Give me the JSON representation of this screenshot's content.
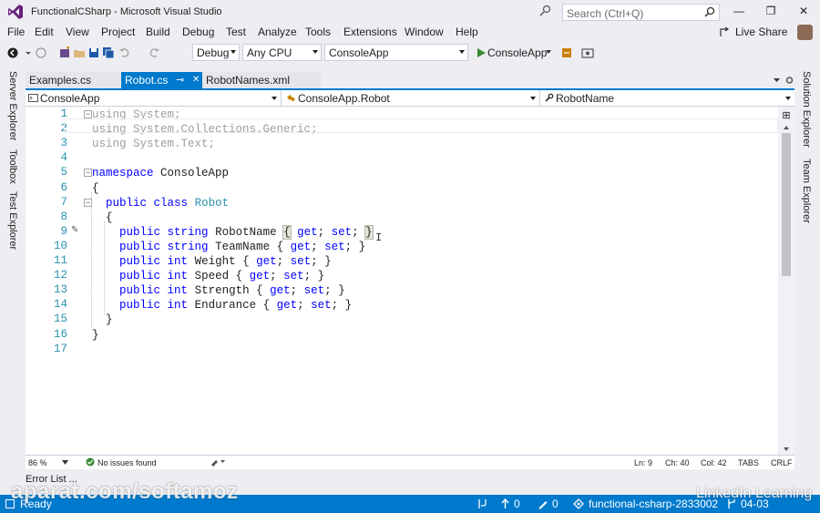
{
  "window": {
    "title": "FunctionalCSharp - Microsoft Visual Studio",
    "search_placeholder": "Search (Ctrl+Q)",
    "minimize": "—",
    "maximize": "❐",
    "close": "✕"
  },
  "menu": [
    "File",
    "Edit",
    "View",
    "Project",
    "Build",
    "Debug",
    "Test",
    "Analyze",
    "Tools",
    "Extensions",
    "Window",
    "Help"
  ],
  "live_share": "Live Share",
  "toolbar": {
    "config": "Debug",
    "platform": "Any CPU",
    "startup_project": "ConsoleApp",
    "run_target": "ConsoleApp"
  },
  "left_rail": [
    "Server Explorer",
    "Toolbox",
    "Test Explorer"
  ],
  "right_rail": [
    "Solution Explorer",
    "Team Explorer"
  ],
  "tabs": [
    {
      "label": "Examples.cs",
      "active": false
    },
    {
      "label": "Robot.cs",
      "active": true
    },
    {
      "label": "RobotNames.xml",
      "active": false
    }
  ],
  "tab_pin": "⊸",
  "tab_close": "✕",
  "navbar": {
    "project": "ConsoleApp",
    "type": "ConsoleApp.Robot",
    "member": "RobotName"
  },
  "code": {
    "line_numbers": [
      "1",
      "2",
      "3",
      "4",
      "5",
      "6",
      "7",
      "8",
      "9",
      "10",
      "11",
      "12",
      "13",
      "14",
      "15",
      "16",
      "17"
    ],
    "lines": [
      [
        {
          "t": "using System;",
          "c": "dim"
        }
      ],
      [
        {
          "t": "using System.Collections.Generic;",
          "c": "dim"
        }
      ],
      [
        {
          "t": "using System.Text;",
          "c": "dim"
        }
      ],
      [],
      [
        {
          "t": "namespace",
          "c": "kw"
        },
        {
          "t": " ConsoleApp",
          "c": ""
        }
      ],
      [
        {
          "t": "{",
          "c": ""
        }
      ],
      [
        {
          "t": "  ",
          "c": ""
        },
        {
          "t": "public",
          "c": "kw"
        },
        {
          "t": " ",
          "c": ""
        },
        {
          "t": "class",
          "c": "kw"
        },
        {
          "t": " ",
          "c": ""
        },
        {
          "t": "Robot",
          "c": "ty"
        }
      ],
      [
        {
          "t": "  {",
          "c": ""
        }
      ],
      [
        {
          "t": "    ",
          "c": ""
        },
        {
          "t": "public",
          "c": "kw"
        },
        {
          "t": " ",
          "c": ""
        },
        {
          "t": "string",
          "c": "kw"
        },
        {
          "t": " RobotName ",
          "c": ""
        },
        {
          "t": "{",
          "c": "hl"
        },
        {
          "t": " ",
          "c": ""
        },
        {
          "t": "get",
          "c": "kw"
        },
        {
          "t": "; ",
          "c": ""
        },
        {
          "t": "set",
          "c": "kw"
        },
        {
          "t": "; ",
          "c": ""
        },
        {
          "t": "}",
          "c": "hl"
        }
      ],
      [
        {
          "t": "    ",
          "c": ""
        },
        {
          "t": "public",
          "c": "kw"
        },
        {
          "t": " ",
          "c": ""
        },
        {
          "t": "string",
          "c": "kw"
        },
        {
          "t": " TeamName { ",
          "c": ""
        },
        {
          "t": "get",
          "c": "kw"
        },
        {
          "t": "; ",
          "c": ""
        },
        {
          "t": "set",
          "c": "kw"
        },
        {
          "t": "; }",
          "c": ""
        }
      ],
      [
        {
          "t": "    ",
          "c": ""
        },
        {
          "t": "public",
          "c": "kw"
        },
        {
          "t": " ",
          "c": ""
        },
        {
          "t": "int",
          "c": "kw"
        },
        {
          "t": " Weight { ",
          "c": ""
        },
        {
          "t": "get",
          "c": "kw"
        },
        {
          "t": "; ",
          "c": ""
        },
        {
          "t": "set",
          "c": "kw"
        },
        {
          "t": "; }",
          "c": ""
        }
      ],
      [
        {
          "t": "    ",
          "c": ""
        },
        {
          "t": "public",
          "c": "kw"
        },
        {
          "t": " ",
          "c": ""
        },
        {
          "t": "int",
          "c": "kw"
        },
        {
          "t": " Speed { ",
          "c": ""
        },
        {
          "t": "get",
          "c": "kw"
        },
        {
          "t": "; ",
          "c": ""
        },
        {
          "t": "set",
          "c": "kw"
        },
        {
          "t": "; }",
          "c": ""
        }
      ],
      [
        {
          "t": "    ",
          "c": ""
        },
        {
          "t": "public",
          "c": "kw"
        },
        {
          "t": " ",
          "c": ""
        },
        {
          "t": "int",
          "c": "kw"
        },
        {
          "t": " Strength { ",
          "c": ""
        },
        {
          "t": "get",
          "c": "kw"
        },
        {
          "t": "; ",
          "c": ""
        },
        {
          "t": "set",
          "c": "kw"
        },
        {
          "t": "; }",
          "c": ""
        }
      ],
      [
        {
          "t": "    ",
          "c": ""
        },
        {
          "t": "public",
          "c": "kw"
        },
        {
          "t": " ",
          "c": ""
        },
        {
          "t": "int",
          "c": "kw"
        },
        {
          "t": " Endurance { ",
          "c": ""
        },
        {
          "t": "get",
          "c": "kw"
        },
        {
          "t": "; ",
          "c": ""
        },
        {
          "t": "set",
          "c": "kw"
        },
        {
          "t": "; }",
          "c": ""
        }
      ],
      [
        {
          "t": "  }",
          "c": ""
        }
      ],
      [
        {
          "t": "}",
          "c": ""
        }
      ],
      []
    ]
  },
  "editor_status": {
    "zoom": "86 %",
    "issues": "No issues found",
    "ln": "Ln: 9",
    "ch": "Ch: 40",
    "col": "Col: 42",
    "tabs": "TABS",
    "eol": "CRLF"
  },
  "error_list": "Error List ...",
  "statusbar": {
    "state": "Ready",
    "up": "0",
    "changes": "0",
    "repo": "functional-csharp-2833002",
    "branch": "04-03"
  },
  "watermark": "aparat.com/softamoz",
  "brand": "LinkedIn Learning",
  "colors": {
    "accent": "#007acc",
    "keyword": "#0000ff",
    "type": "#2b91af"
  }
}
